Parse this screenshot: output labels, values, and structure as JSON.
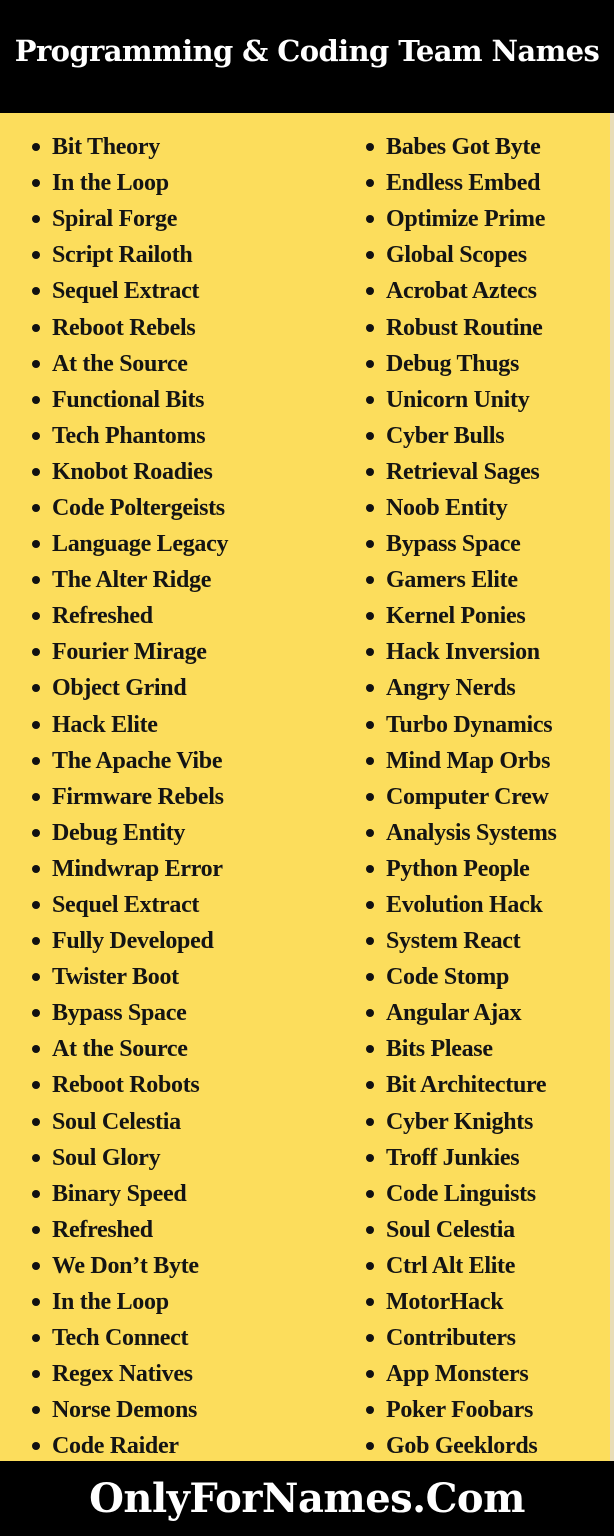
{
  "header": {
    "title": "Programming & Coding Team Names"
  },
  "lists": {
    "left": [
      "Bit Theory",
      "In the Loop",
      "Spiral Forge",
      "Script Railoth",
      "Sequel Extract",
      "Reboot Rebels",
      "At the Source",
      "Functional Bits",
      "Tech Phantoms",
      "Knobot Roadies",
      "Code Poltergeists",
      "Language Legacy",
      "The Alter Ridge",
      "Refreshed",
      "Fourier Mirage",
      "Object Grind",
      "Hack Elite",
      "The Apache Vibe",
      "Firmware Rebels",
      "Debug Entity",
      "Mindwrap Error",
      "Sequel Extract",
      "Fully Developed",
      "Twister Boot",
      "Bypass Space",
      "At the Source",
      "Reboot Robots",
      "Soul Celestia",
      "Soul Glory",
      "Binary Speed",
      "Refreshed",
      "We Don’t Byte",
      "In the Loop",
      "Tech Connect",
      "Regex Natives",
      "Norse Demons",
      "Code Raider"
    ],
    "right": [
      "Babes Got Byte",
      "Endless Embed",
      "Optimize Prime",
      "Global Scopes",
      "Acrobat Aztecs",
      "Robust Routine",
      "Debug Thugs",
      "Unicorn Unity",
      "Cyber Bulls",
      "Retrieval Sages",
      "Noob Entity",
      "Bypass Space",
      "Gamers Elite",
      "Kernel Ponies",
      "Hack Inversion",
      "Angry Nerds",
      "Turbo Dynamics",
      "Mind Map Orbs",
      "Computer Crew",
      "Analysis Systems",
      "Python People",
      "Evolution Hack",
      "System React",
      "Code Stomp",
      "Angular Ajax",
      "Bits Please",
      "Bit Architecture",
      "Cyber Knights",
      "Troff Junkies",
      "Code Linguists",
      "Soul Celestia",
      "Ctrl Alt Elite",
      "MotorHack",
      "Contributers",
      "App Monsters",
      "Poker Foobars",
      "Gob Geeklords"
    ]
  },
  "footer": {
    "brand": "OnlyForNames.Com"
  },
  "colors": {
    "header_bg": "#000000",
    "body_bg": "#fcdd5c",
    "text": "#141414",
    "header_text": "#ffffff"
  }
}
